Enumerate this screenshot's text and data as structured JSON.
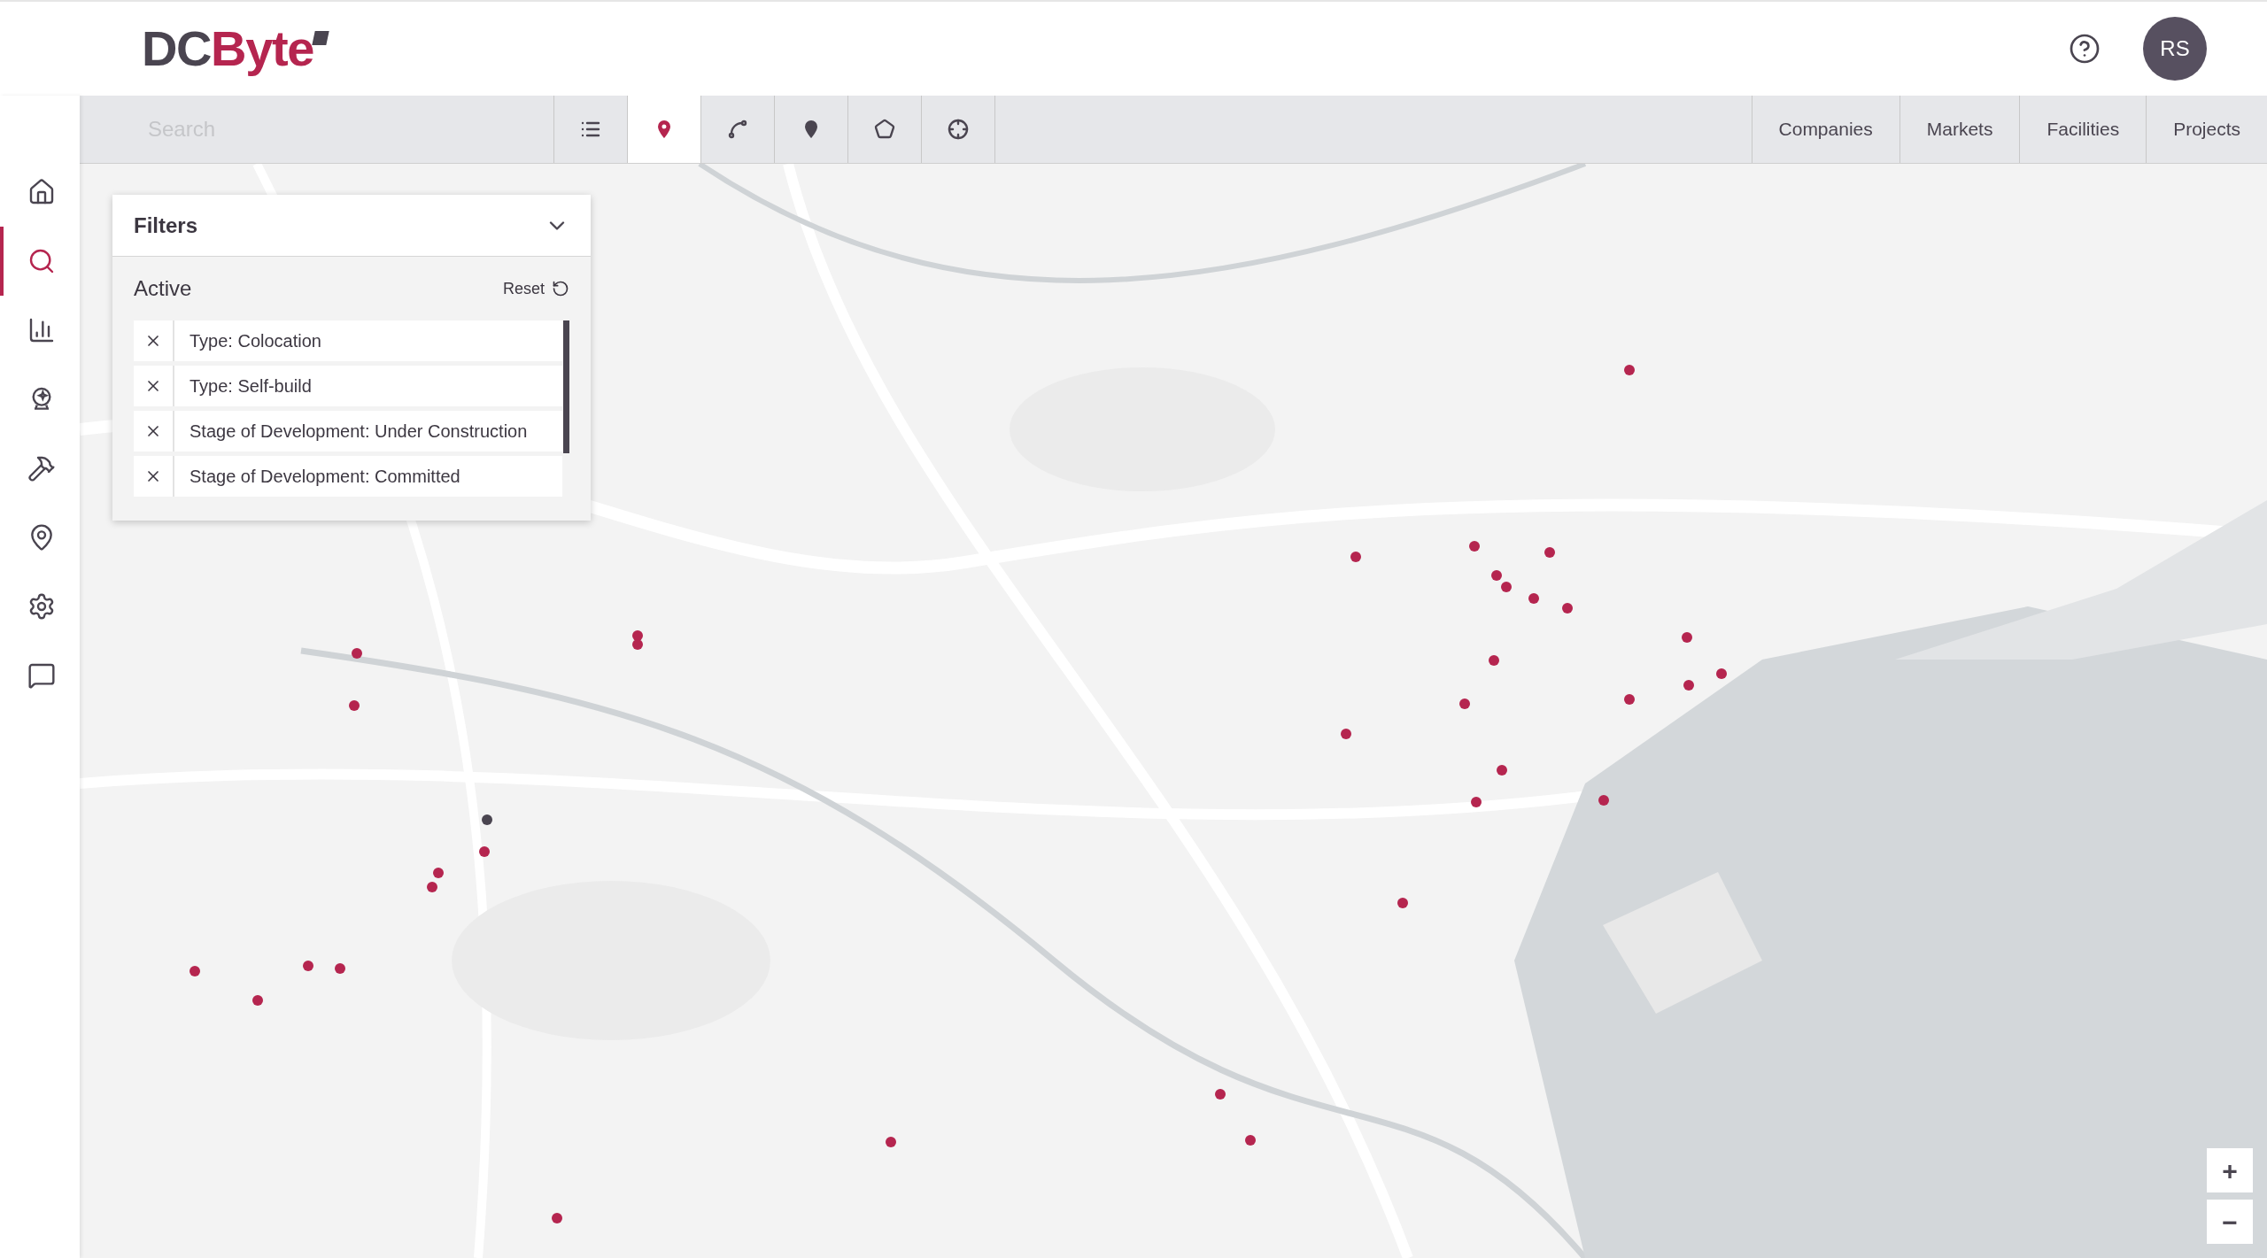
{
  "header": {
    "logo": {
      "part_1": "DC",
      "part_2": "Byte"
    },
    "user_initials": "RS"
  },
  "sidebar": {
    "items": [
      {
        "kind": "home",
        "selected": false
      },
      {
        "kind": "search",
        "selected": true
      },
      {
        "kind": "chart",
        "selected": false
      },
      {
        "kind": "insight",
        "selected": false
      },
      {
        "kind": "build",
        "selected": false
      },
      {
        "kind": "location",
        "selected": false
      },
      {
        "kind": "settings",
        "selected": false
      },
      {
        "kind": "feedback",
        "selected": false
      }
    ]
  },
  "toolbar": {
    "search": {
      "placeholder": "Search"
    },
    "tools": [
      {
        "kind": "list",
        "selected": false
      },
      {
        "kind": "pin",
        "selected": true
      },
      {
        "kind": "line",
        "selected": false
      },
      {
        "kind": "marker",
        "selected": false
      },
      {
        "kind": "polygon",
        "selected": false
      },
      {
        "kind": "circle",
        "selected": false
      }
    ],
    "tabs": [
      {
        "label": "Companies",
        "selected": false
      },
      {
        "label": "Markets",
        "selected": false
      },
      {
        "label": "Facilities",
        "selected": false
      },
      {
        "label": "Projects",
        "selected": false
      }
    ]
  },
  "filters": {
    "title": "Filters",
    "expanded": true,
    "active_label": "Active",
    "reset": "Reset",
    "chips": [
      "Type: Colocation",
      "Type: Self-build",
      "Stage of Development: Under Construction",
      "Stage of Development: Committed"
    ]
  },
  "map": {
    "zoom_in": "+",
    "zoom_out": "−"
  }
}
